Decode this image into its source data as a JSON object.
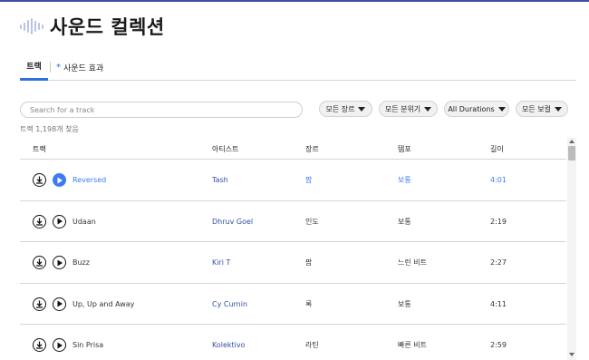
{
  "header": {
    "title": "사운드 컬렉션",
    "icon": "audio-wave-icon"
  },
  "tabs": [
    {
      "label": "트랙",
      "active": true
    },
    {
      "label": "사운드 효과",
      "active": false,
      "marker": "*"
    }
  ],
  "search": {
    "placeholder": "Search for a track",
    "value": ""
  },
  "filters": [
    {
      "label": "모든 장르"
    },
    {
      "label": "모든 분위기"
    },
    {
      "label": "All Durations"
    },
    {
      "label": "모든 보컬"
    }
  ],
  "result_count": "트랙 1,198개 찾음",
  "table": {
    "columns": [
      "트랙",
      "아티스트",
      "장르",
      "템포",
      "길이"
    ],
    "rows": [
      {
        "title": "Reversed",
        "artist": "Tash",
        "genre": "팝",
        "tempo": "보통",
        "length": "4:01",
        "playing": true
      },
      {
        "title": "Udaan",
        "artist": "Dhruv Goel",
        "genre": "인도",
        "tempo": "보통",
        "length": "2:19",
        "playing": false
      },
      {
        "title": "Buzz",
        "artist": "Kiri T",
        "genre": "팝",
        "tempo": "느린 비트",
        "length": "2:27",
        "playing": false
      },
      {
        "title": "Up, Up and Away",
        "artist": "Cy Curnin",
        "genre": "록",
        "tempo": "보통",
        "length": "4:11",
        "playing": false
      },
      {
        "title": "Sin Prisa",
        "artist": "Kolektivo",
        "genre": "라틴",
        "tempo": "빠른 비트",
        "length": "2:59",
        "playing": false
      }
    ]
  },
  "colors": {
    "accent": "#3e7bf2",
    "artist_link": "#2f4f9e",
    "top_bar": "#3d4f9f"
  }
}
